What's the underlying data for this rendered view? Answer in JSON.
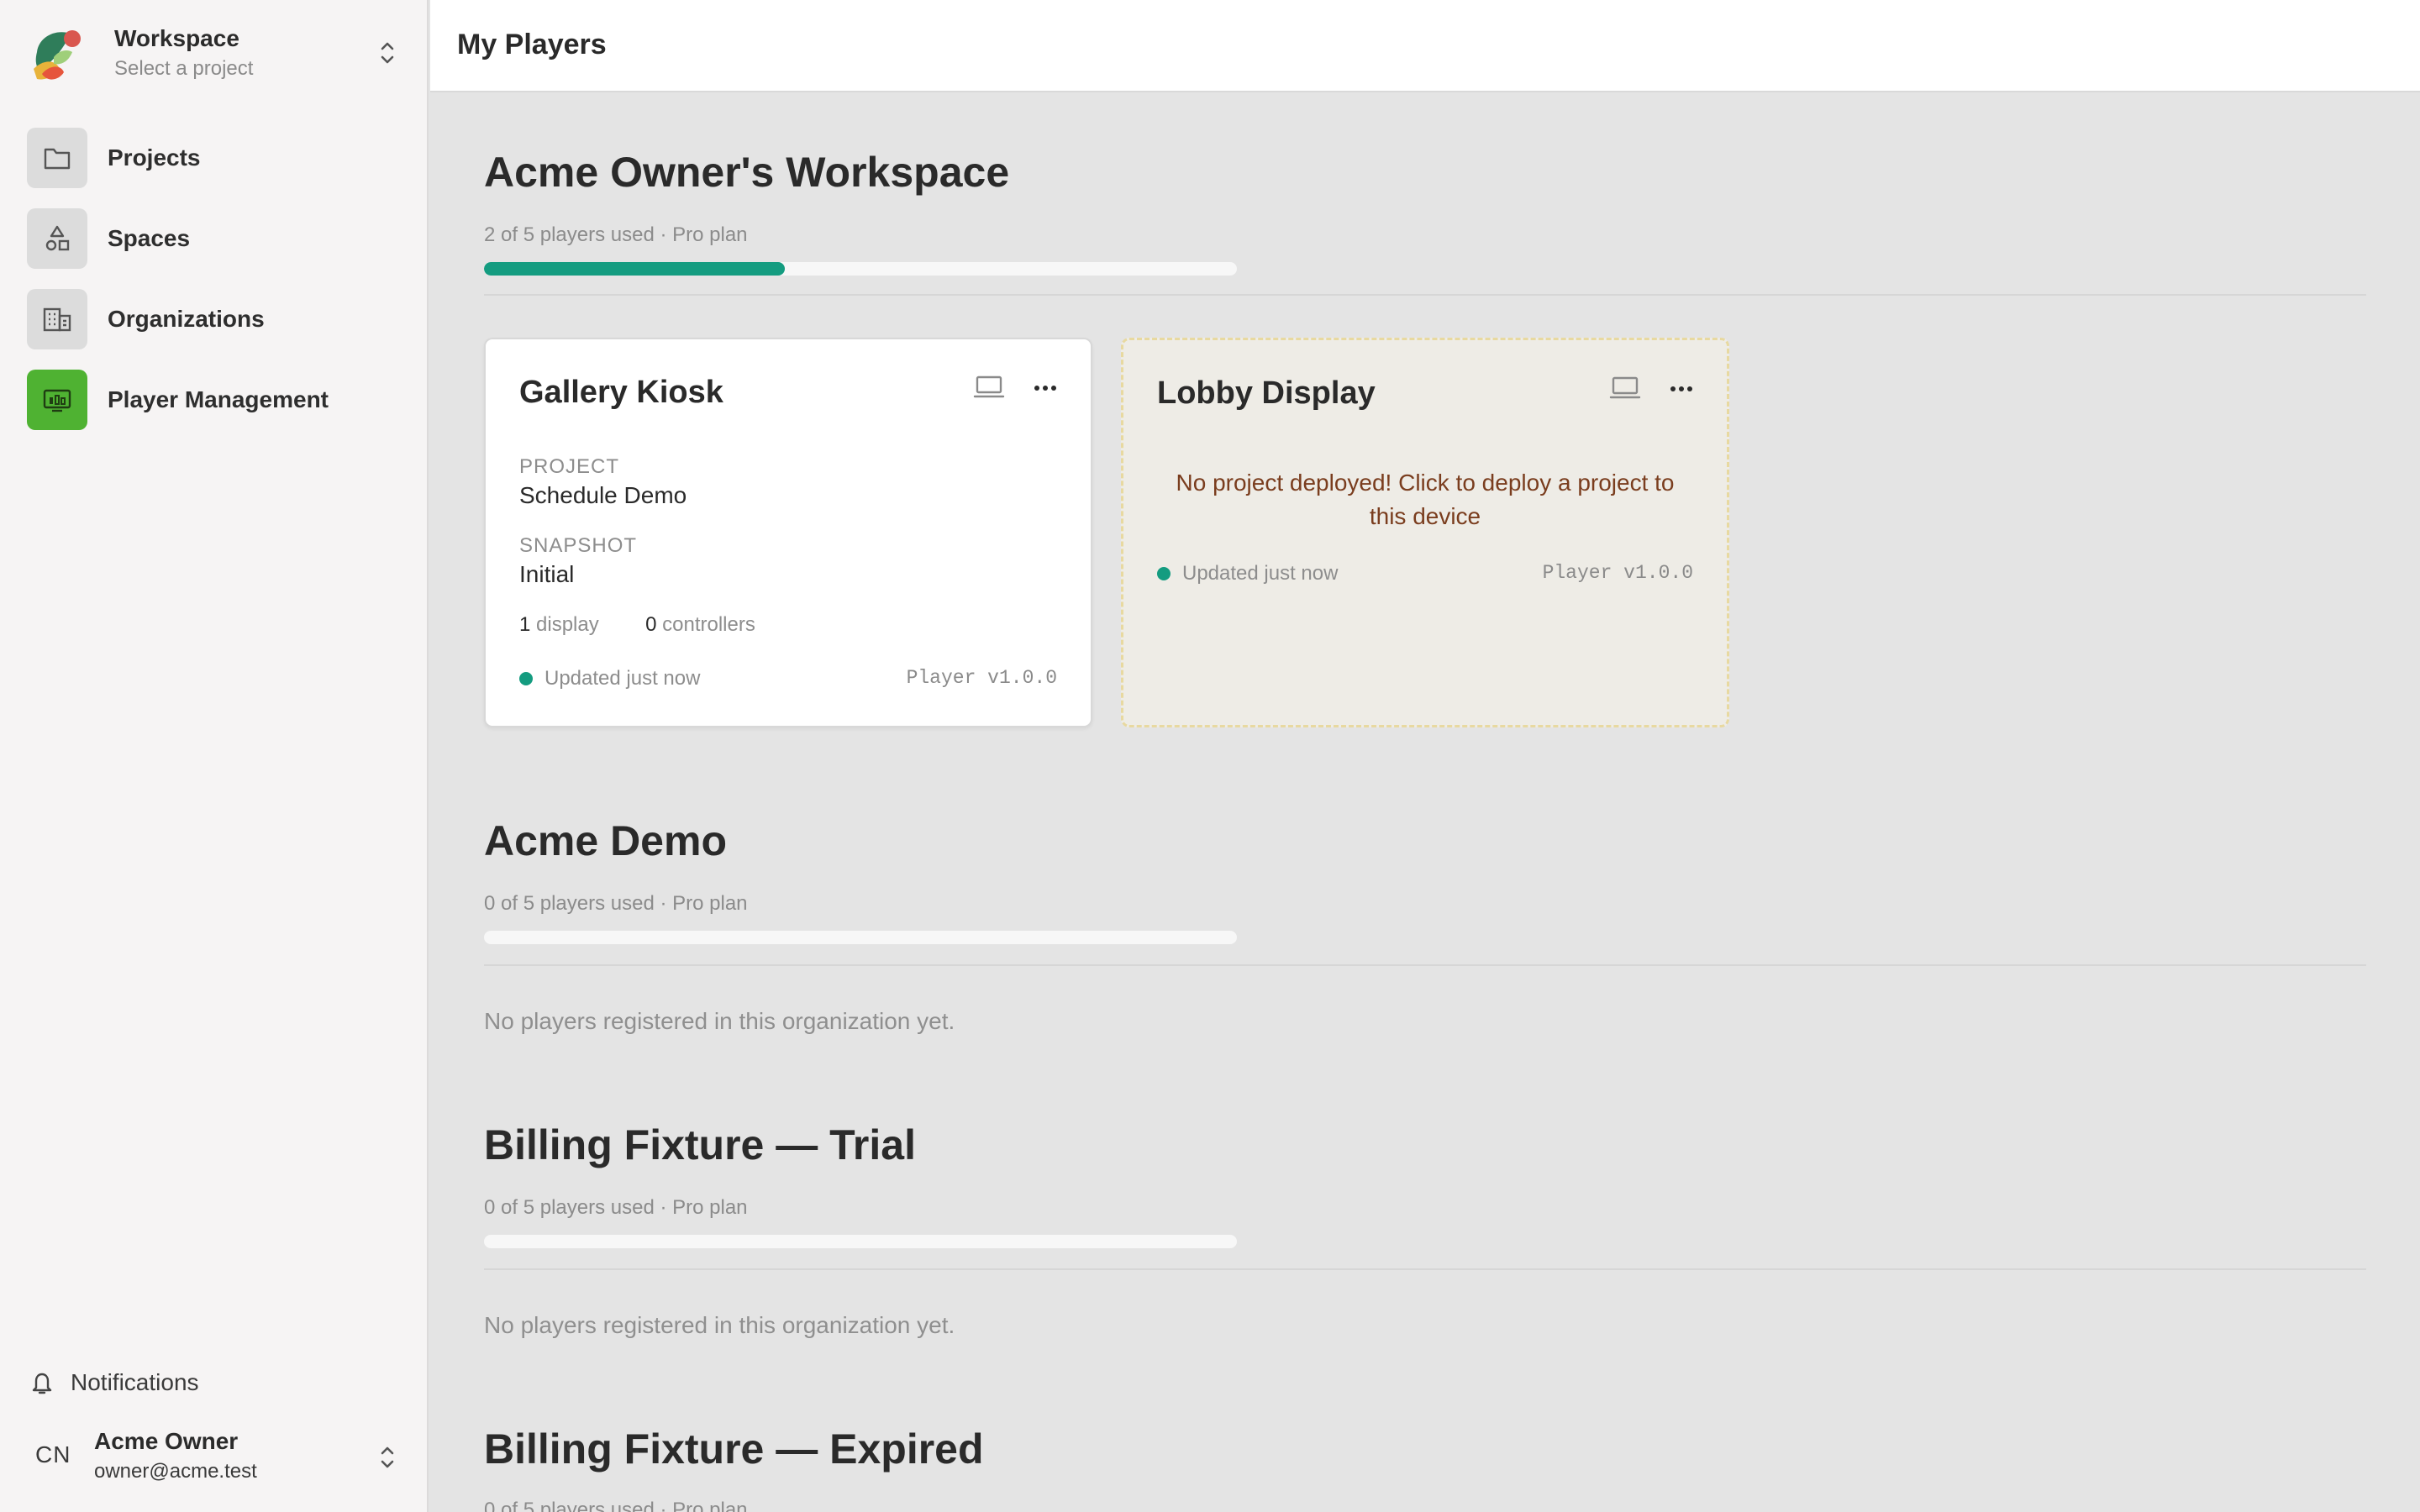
{
  "sidebar": {
    "workspace_title": "Workspace",
    "workspace_subtitle": "Select a project",
    "items": [
      {
        "label": "Projects"
      },
      {
        "label": "Spaces"
      },
      {
        "label": "Organizations"
      },
      {
        "label": "Player Management"
      }
    ],
    "notifications_label": "Notifications",
    "user": {
      "initials": "CN",
      "name": "Acme Owner",
      "email": "owner@acme.test"
    }
  },
  "header": {
    "title": "My Players"
  },
  "orgs": [
    {
      "title": "Acme Owner's Workspace",
      "usage": "2 of 5 players used · Pro plan",
      "used": 2,
      "capacity": 5,
      "players": [
        {
          "name": "Gallery Kiosk",
          "project_label": "PROJECT",
          "project": "Schedule Demo",
          "snapshot_label": "SNAPSHOT",
          "snapshot": "Initial",
          "displays_count": "1",
          "displays_label": "display",
          "controllers_count": "0",
          "controllers_label": "controllers",
          "status": "Updated just now",
          "version": "Player v1.0.0"
        },
        {
          "name": "Lobby Display",
          "warning": "No project deployed! Click to deploy a project to this device",
          "status": "Updated just now",
          "version": "Player v1.0.0"
        }
      ]
    },
    {
      "title": "Acme Demo",
      "usage": "0 of 5 players used · Pro plan",
      "used": 0,
      "capacity": 5,
      "empty_message": "No players registered in this organization yet."
    },
    {
      "title": "Billing Fixture — Trial",
      "usage": "0 of 5 players used · Pro plan",
      "used": 0,
      "capacity": 5,
      "empty_message": "No players registered in this organization yet."
    },
    {
      "title": "Billing Fixture — Expired",
      "usage": "0 of 5 players used · Pro plan",
      "used": 0,
      "capacity": 5
    }
  ],
  "colors": {
    "accent": "#149c80",
    "active_nav": "#4fb232",
    "warning_text": "#7a3d1e",
    "warning_border": "#e8d9a0"
  },
  "icons": [
    "workspace-logo-icon",
    "chevron-updown-icon",
    "folder-icon",
    "shapes-icon",
    "building-icon",
    "player-icon",
    "bell-icon",
    "laptop-icon",
    "more-icon"
  ]
}
